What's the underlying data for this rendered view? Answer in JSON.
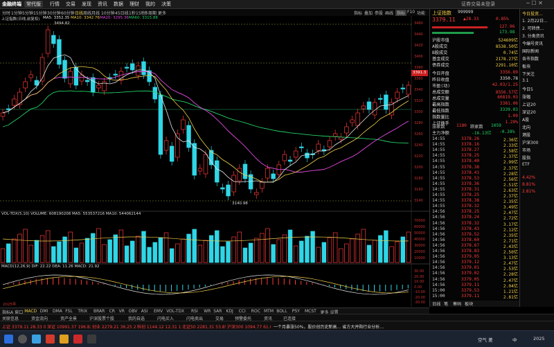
{
  "topbar": {
    "app_title": "金融终端",
    "dropdown": "常代版",
    "menus": [
      "行情",
      "交易",
      "发现",
      "资讯",
      "数据",
      "理财",
      "我的",
      "决策"
    ],
    "right_text": "证券交易未登录"
  },
  "toolbar": {
    "periods": [
      "分时",
      "1分钟",
      "5分钟",
      "15分钟",
      "30分钟",
      "60分钟",
      "日线",
      "周线",
      "月线",
      "10分钟",
      "45日线",
      "1秒",
      "15秒",
      "多周期",
      "更多"
    ],
    "right_buttons": [
      "指标",
      "叠加",
      "参股",
      "画线",
      "指标",
      "F10",
      "功能"
    ],
    "chart_subtitle": "上证指数(日线,前复权)"
  },
  "chart_main": {
    "ma_legend": [
      {
        "label": "MA5: 3352.35",
        "color": "#e8e8e8"
      },
      {
        "label": "MA10: 3342.76",
        "color": "#f3d04a"
      },
      {
        "label": "MA20: 3295.36",
        "color": "#e14ae1"
      },
      {
        "label": "MA60: 3315.88",
        "color": "#25d366"
      }
    ],
    "high_label": "3494.82",
    "low_label": "3140.98",
    "price_tag": "3391.3",
    "y_ticks": [
      "3460",
      "3440",
      "3420",
      "3400",
      "3380",
      "3360",
      "3340",
      "3320",
      "3300",
      "3280",
      "3260",
      "3240",
      "3220",
      "3200",
      "3180",
      "3160",
      "3140"
    ]
  },
  "chart_volume": {
    "legend": "VOL-TDX(5,10)  VOLUME: 608190208  MA5: 553537216  MA10: 544062144",
    "y_ticks": [
      "70000",
      "60000",
      "50000",
      "40000",
      "30000",
      "20000",
      "10000"
    ]
  },
  "chart_macd": {
    "legend": "MACD(12,26,9)  DIF: 22.22  DEA: 11.26  MACD: 21.92",
    "y_ticks": [
      "30.00",
      "20.00",
      "10.00",
      "0.00",
      "-10.00",
      "-20.00",
      "-30.00"
    ],
    "date_label": "2025年"
  },
  "quote": {
    "name": "上证指数",
    "code": "999999",
    "price": "3379.11",
    "change": "▲28.33",
    "pct": "0.85%",
    "side_vals": [
      "127.96",
      "173.98"
    ],
    "rows": [
      {
        "label": "沪股市值",
        "value": "524609亿"
      },
      {
        "label": "A股成交",
        "value": "8538.50亿"
      },
      {
        "label": "B股成交",
        "value": "0.74亿"
      },
      {
        "label": "基金成交",
        "value": "2178.27亿"
      },
      {
        "label": "债券成交",
        "value": "2291.10亿"
      },
      {
        "label": "今日开盘",
        "value": "3356.89"
      },
      {
        "label": "昨日收盘",
        "value": "3350.78"
      },
      {
        "label": "市盈(动)",
        "value": "42.03/1.25"
      },
      {
        "label": "总成交额",
        "value": "8556.57亿"
      },
      {
        "label": "总成交量",
        "value": "60819.03"
      },
      {
        "label": "最高指数",
        "value": "3381.06"
      },
      {
        "label": "最低指数",
        "value": "3339.03"
      },
      {
        "label": "指数量比",
        "value": "1.09"
      },
      {
        "label": "上证换手",
        "value": "1.29%"
      }
    ],
    "up_down_label": "涨家数",
    "up_count": "1180",
    "down_label": "跌家数",
    "down_count": "1059",
    "main_force_label": "主力净额",
    "main_force_value": "-16.13亿",
    "main_force_pct": "-0.28%"
  },
  "ticks": [
    {
      "t": "14:55",
      "p": "3378.26",
      "v": "2.36亿"
    },
    {
      "t": "14:55",
      "p": "3378.16",
      "v": "2.33亿"
    },
    {
      "t": "14:55",
      "p": "3378.27",
      "v": "2.58亿"
    },
    {
      "t": "14:55",
      "p": "3378.25",
      "v": "2.37亿"
    },
    {
      "t": "14:55",
      "p": "3378.40",
      "v": "2.99亿"
    },
    {
      "t": "14:55",
      "p": "3378.38",
      "v": "2.37亿"
    },
    {
      "t": "14:55",
      "p": "3378.41",
      "v": "2.28亿"
    },
    {
      "t": "14:55",
      "p": "3378.53",
      "v": "2.56亿"
    },
    {
      "t": "14:55",
      "p": "3378.36",
      "v": "2.51亿"
    },
    {
      "t": "14:55",
      "p": "3378.31",
      "v": "2.63亿"
    },
    {
      "t": "14:55",
      "p": "3378.25",
      "v": "2.37亿"
    },
    {
      "t": "14:55",
      "p": "3378.38",
      "v": "2.35亿"
    },
    {
      "t": "14:55",
      "p": "3378.32",
      "v": "3.49亿"
    },
    {
      "t": "14:56",
      "p": "3378.25",
      "v": "2.47亿"
    },
    {
      "t": "14:56",
      "p": "3378.24",
      "v": "2.72亿"
    },
    {
      "t": "14:56",
      "p": "3378.32",
      "v": "3.17亿"
    },
    {
      "t": "14:56",
      "p": "3378.43",
      "v": "2.12亿"
    },
    {
      "t": "14:56",
      "p": "3378.52",
      "v": "2.35亿"
    },
    {
      "t": "14:56",
      "p": "3378.60",
      "v": "2.71亿"
    },
    {
      "t": "14:56",
      "p": "3378.67",
      "v": "2.43亿"
    },
    {
      "t": "14:56",
      "p": "3378.83",
      "v": "2.50亿"
    },
    {
      "t": "14:56",
      "p": "3379.05",
      "v": "3.13亿"
    },
    {
      "t": "14:56",
      "p": "3379.12",
      "v": "2.47亿"
    },
    {
      "t": "14:56",
      "p": "3379.01",
      "v": "2.53亿"
    },
    {
      "t": "14:56",
      "p": "3379.02",
      "v": "2.28亿"
    },
    {
      "t": "14:56",
      "p": "3379.05",
      "v": "2.47亿"
    },
    {
      "t": "14:56",
      "p": "3379.11",
      "v": "2.04亿"
    },
    {
      "t": "15:00",
      "p": "3379.53",
      "v": "1.21亿"
    },
    {
      "t": "15:00",
      "p": "3379.11",
      "v": "2.81亿"
    }
  ],
  "bottom_tabs": [
    "指标A",
    "窗口",
    "MACD",
    "DMI",
    "DMA",
    "FSL",
    "TRIX",
    "BRAR",
    "CR",
    "VR",
    "OBV",
    "ASI",
    "EMV",
    "VOL-TDX",
    "RSI",
    "WR",
    "SAR",
    "KDJ",
    "CCI",
    "ROC",
    "MTM",
    "BOLL",
    "PSY",
    "MCST",
    "更多",
    "设置"
  ],
  "right_bottom_tabs": [
    "日线",
    "笔",
    "筹码",
    "板块"
  ],
  "news_panel": {
    "title": "今日投资...",
    "items": [
      "1. 2月22日...",
      "2. 可转债...",
      "3. 分类资讯",
      "今编号资讯",
      "国际新闻",
      "各市指数",
      "板块",
      "下关注",
      "3.1",
      "今日5",
      "涨幅",
      "上证20",
      "深证20",
      "A股",
      "北向",
      "港股",
      "沪深300",
      "市场",
      "股指",
      "ETF"
    ],
    "stats": [
      "4.42%",
      "8.81%",
      "2.81%"
    ]
  },
  "status": {
    "items": [
      "关联信息",
      "资金流向",
      "资产全景",
      "沪深股票个股",
      "我的自选",
      "闪电买入",
      "闪电卖出",
      "交易",
      "预警委托",
      "资讯",
      "已连接"
    ],
    "ticker_items": [
      {
        "text": "上证 3379.11  28.33  0.85%  8556亿",
        "color": "#ff3b3b"
      },
      {
        "text": "深证 10991.37  196.82  1.82%  13370亿",
        "color": "#ff3b3b"
      },
      {
        "text": "创业 2279.21  36.25  2.47%  6993亿",
        "color": "#ff3b3b"
      },
      {
        "text": "科创 1144.12  12.31  1.09%  390.2亿",
        "color": "#ff3b3b"
      },
      {
        "text": "北证50 2281.31  53.85  2.51%  6693亿",
        "color": "#ff3b3b"
      },
      {
        "text": "沪深300 1094.77  61.68  5.97%  2142亿",
        "color": "#ff3b3b"
      }
    ],
    "ticker_news": "一个月暴涨50%，股价创历史新高… 省方大并购行业分析…"
  },
  "taskbar": {
    "weather": "空气 差",
    "ime": "中",
    "time": "2025"
  }
}
